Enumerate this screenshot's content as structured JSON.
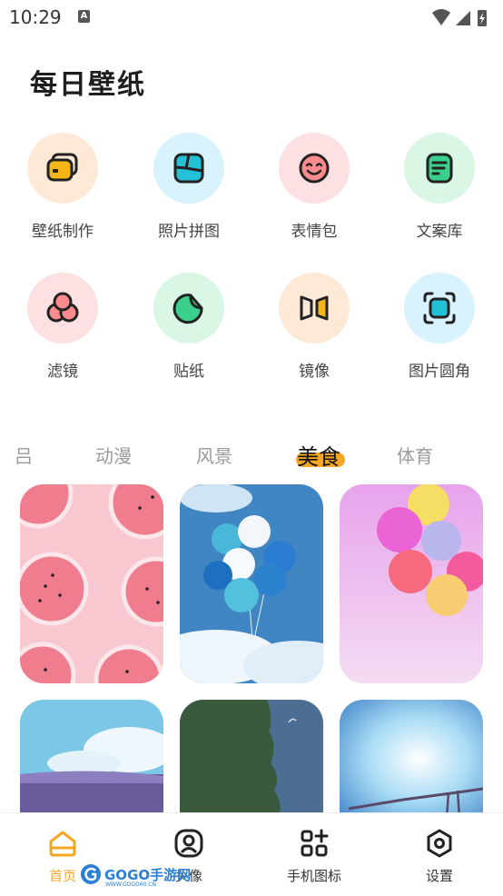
{
  "status": {
    "time": "10:29",
    "badge": "A"
  },
  "page_title": "每日壁纸",
  "tools": [
    {
      "label": "壁纸制作",
      "icon": "wallpaper-cards-icon",
      "bg": "#fde9d6",
      "accent": "#f7b617"
    },
    {
      "label": "照片拼图",
      "icon": "photo-collage-icon",
      "bg": "#d8f3fb",
      "accent": "#24c1d6"
    },
    {
      "label": "表情包",
      "icon": "smiley-face-icon",
      "bg": "#fde0e2",
      "accent": "#fb8b8f"
    },
    {
      "label": "文案库",
      "icon": "text-note-icon",
      "bg": "#d9f7e4",
      "accent": "#3ad08b"
    },
    {
      "label": "滤镜",
      "icon": "filter-circles-icon",
      "bg": "#fde0e2",
      "accent": "#fb8b8f"
    },
    {
      "label": "贴纸",
      "icon": "sticker-icon",
      "bg": "#d9f7e4",
      "accent": "#3ad08b"
    },
    {
      "label": "镜像",
      "icon": "mirror-icon",
      "bg": "#fde9d6",
      "accent": "#f7b617"
    },
    {
      "label": "图片圆角",
      "icon": "round-corner-icon",
      "bg": "#d8f3fb",
      "accent": "#24c1d6"
    }
  ],
  "categories": [
    {
      "label": "吕",
      "active": false
    },
    {
      "label": "动漫",
      "active": false
    },
    {
      "label": "风景",
      "active": false
    },
    {
      "label": "美食",
      "active": true
    },
    {
      "label": "体育",
      "active": false
    }
  ],
  "wallpapers": [
    {
      "name": "watermelon-slices"
    },
    {
      "name": "blue-balloons-sky"
    },
    {
      "name": "pink-balloons"
    },
    {
      "name": "anime-sea-sky"
    },
    {
      "name": "green-tree-silhouette"
    },
    {
      "name": "sunlit-clouds-swing"
    }
  ],
  "bottom_nav": [
    {
      "label": "首页",
      "icon": "home-icon",
      "active": true
    },
    {
      "label": "头像",
      "icon": "avatar-icon",
      "active": false
    },
    {
      "label": "手机图标",
      "icon": "grid-plus-icon",
      "active": false
    },
    {
      "label": "设置",
      "icon": "settings-hexagon-icon",
      "active": false
    }
  ],
  "watermark": {
    "text": "GOGO手游网",
    "sub": "WWW.GOGO60.CN"
  },
  "colors": {
    "accent": "#f6a623",
    "title": "#1e1e1e"
  }
}
